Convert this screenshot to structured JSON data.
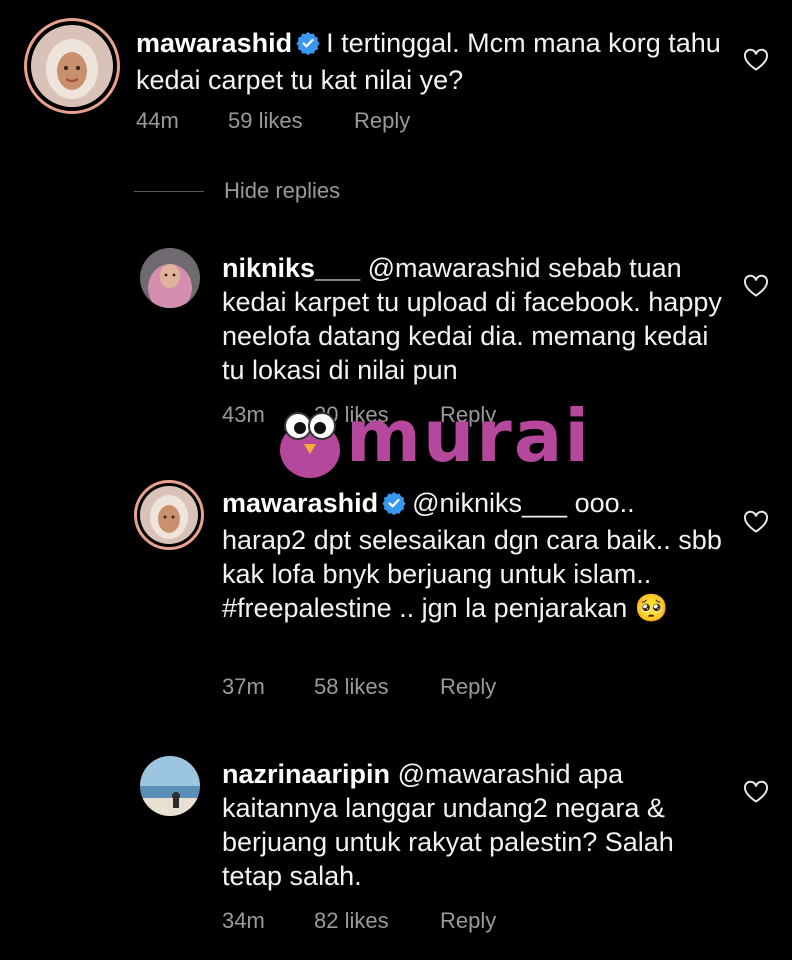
{
  "comments": [
    {
      "username": "mawarashid",
      "verified": true,
      "text": "I tertinggal. Mcm mana korg tahu kedai carpet tu kat nilai ye?",
      "age": "44m",
      "likes": "59 likes",
      "reply_label": "Reply"
    },
    {
      "username": "nikniks___",
      "verified": false,
      "text": "@mawarashid sebab tuan kedai karpet tu upload di facebook. happy neelofa datang kedai dia. memang kedai tu lokasi di nilai pun",
      "age": "43m",
      "likes": "20 likes",
      "reply_label": "Reply"
    },
    {
      "username": "mawarashid",
      "verified": true,
      "text": "@nikniks___ ooo.. harap2 dpt selesaikan dgn cara baik.. sbb kak lofa bnyk berjuang untuk islam.. #freepalestine .. jgn la penjarakan 🥺",
      "age": "37m",
      "likes": "58 likes",
      "reply_label": "Reply"
    },
    {
      "username": "nazrinaaripin",
      "verified": false,
      "text": "@mawarashid apa kaitannya langgar undang2 negara & berjuang untuk rakyat palestin? Salah tetap salah.",
      "age": "34m",
      "likes": "82 likes",
      "reply_label": "Reply"
    }
  ],
  "hide_replies_label": "Hide replies",
  "watermark": {
    "text": "murai",
    "color": "#b5479c"
  },
  "icons": {
    "like": "heart-outline-icon",
    "verified": "verified-badge-icon"
  },
  "colors": {
    "background": "#000000",
    "meta_text": "#9a9a9a",
    "verified_blue": "#3897f0",
    "story_ring": "#e8a08f"
  }
}
